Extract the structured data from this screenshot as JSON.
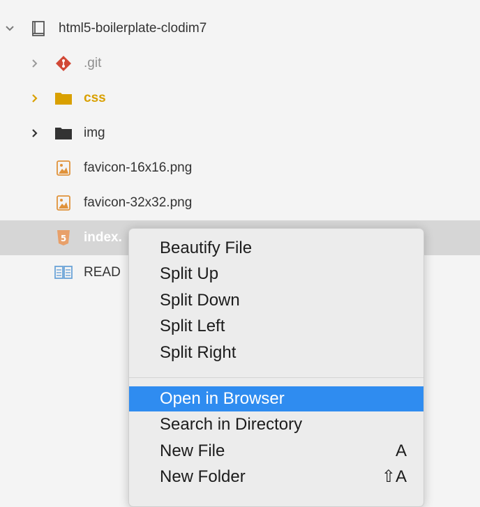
{
  "colors": {
    "accent_folder": "#d9a000",
    "git_red": "#d14836",
    "html5_orange": "#e8a06a",
    "menu_highlight": "#2f8cf0",
    "readme_blue": "#6aa3d8"
  },
  "tree": {
    "root": {
      "label": "html5-boilerplate-clodim7",
      "icon": "book-icon",
      "expanded": true
    },
    "items": [
      {
        "label": ".git",
        "icon": "git-icon",
        "type": "folder"
      },
      {
        "label": "css",
        "icon": "folder-icon",
        "type": "folder"
      },
      {
        "label": "img",
        "icon": "folder-icon",
        "type": "folder"
      },
      {
        "label": "favicon-16x16.png",
        "icon": "image-file-icon",
        "type": "file"
      },
      {
        "label": "favicon-32x32.png",
        "icon": "image-file-icon",
        "type": "file"
      },
      {
        "label": "index.",
        "icon": "html5-icon",
        "type": "file",
        "selected": true
      },
      {
        "label": "READ",
        "icon": "book-open-icon",
        "type": "file"
      }
    ]
  },
  "context_menu": {
    "items": [
      {
        "label": "Beautify File",
        "shortcut": ""
      },
      {
        "label": "Split Up",
        "shortcut": ""
      },
      {
        "label": "Split Down",
        "shortcut": ""
      },
      {
        "label": "Split Left",
        "shortcut": ""
      },
      {
        "label": "Split Right",
        "shortcut": ""
      },
      {
        "label": "Open in Browser",
        "shortcut": "",
        "highlighted": true
      },
      {
        "label": "Search in Directory",
        "shortcut": ""
      },
      {
        "label": "New File",
        "shortcut": "A"
      },
      {
        "label": "New Folder",
        "shortcut": "⇧A"
      }
    ]
  }
}
